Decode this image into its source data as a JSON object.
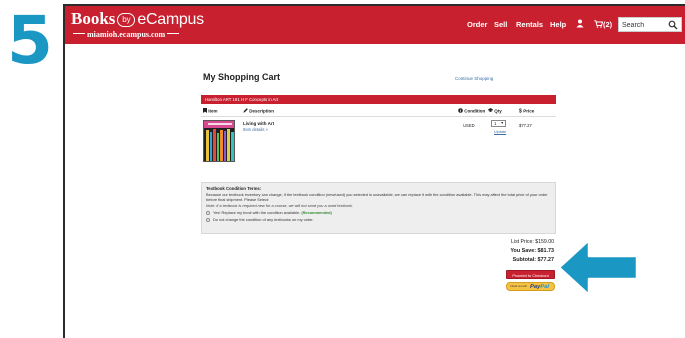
{
  "step_number": "5",
  "header": {
    "logo": {
      "main": "Books",
      "by": "by",
      "brand": "eCampus",
      "sub": "miamioh.ecampus.com"
    },
    "nav": [
      "Order",
      "Sell",
      "Rentals",
      "Help"
    ],
    "cart_label": "(2)",
    "search_placeholder": "Search"
  },
  "cart": {
    "title": "My Shopping Cart",
    "continue_link": "Continue Shopping",
    "course_bar": "Hamilton  ART  181  H F  Concepts in Art",
    "columns": {
      "item": "Item",
      "description": "Description",
      "condition": "Condition",
      "qty": "Qty",
      "price": "Price"
    },
    "line_item": {
      "title": "Living with Art",
      "details_link": "Item details »",
      "condition": "USED",
      "qty": "1",
      "update": "Update",
      "price": "$77.27"
    },
    "terms": {
      "title": "Textbook Condition Terms:",
      "body": "Because our textbook inventory can change, if the textbook condition (new/used) you selected is unavailable, we can replace it with the condition available. This may affect the total price of your order before final shipment. Please Select:",
      "note": "Note: if a textbook is required new for a course, we will not send you a used textbook.",
      "option1": "Yes! Replace my book with the condition available.",
      "option1_tag": "(Recommended)",
      "option2": "Do not change the condition of any textbooks on my order."
    },
    "totals": {
      "list_price": "List Price: $159.00",
      "you_save": "You Save: $81.73",
      "subtotal": "Subtotal: $77.27"
    },
    "checkout_button": "Proceed to Checkout",
    "paypal": {
      "prefix": "Check out with",
      "pay": "Pay",
      "pal": "Pal"
    }
  },
  "colors": {
    "brand_red": "#c9202f",
    "step_blue": "#1b97c4",
    "arrow_teal": "#1b97c4",
    "paypal_gold": "#f6c244"
  }
}
